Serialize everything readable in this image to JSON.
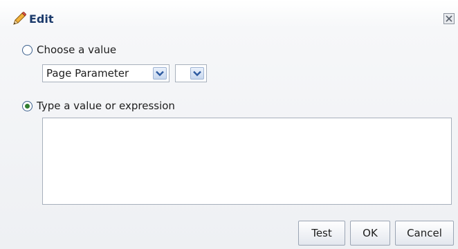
{
  "dialog": {
    "title": "Edit",
    "icons": {
      "title": "pencil-icon",
      "close": "close-icon",
      "dropdown": "chevron-down-icon"
    }
  },
  "options": {
    "choose": {
      "label": "Choose a value",
      "selected": false
    },
    "type": {
      "label": "Type a value or expression",
      "selected": true
    }
  },
  "choose_selects": {
    "source": "Page Parameter",
    "parameter": ""
  },
  "expression_value": "",
  "buttons": {
    "test": "Test",
    "ok": "OK",
    "cancel": "Cancel"
  },
  "colors": {
    "title_text": "#1b3a6b",
    "radio_selected_dot": "#2f7d2f",
    "pencil": "#e09a1c"
  }
}
